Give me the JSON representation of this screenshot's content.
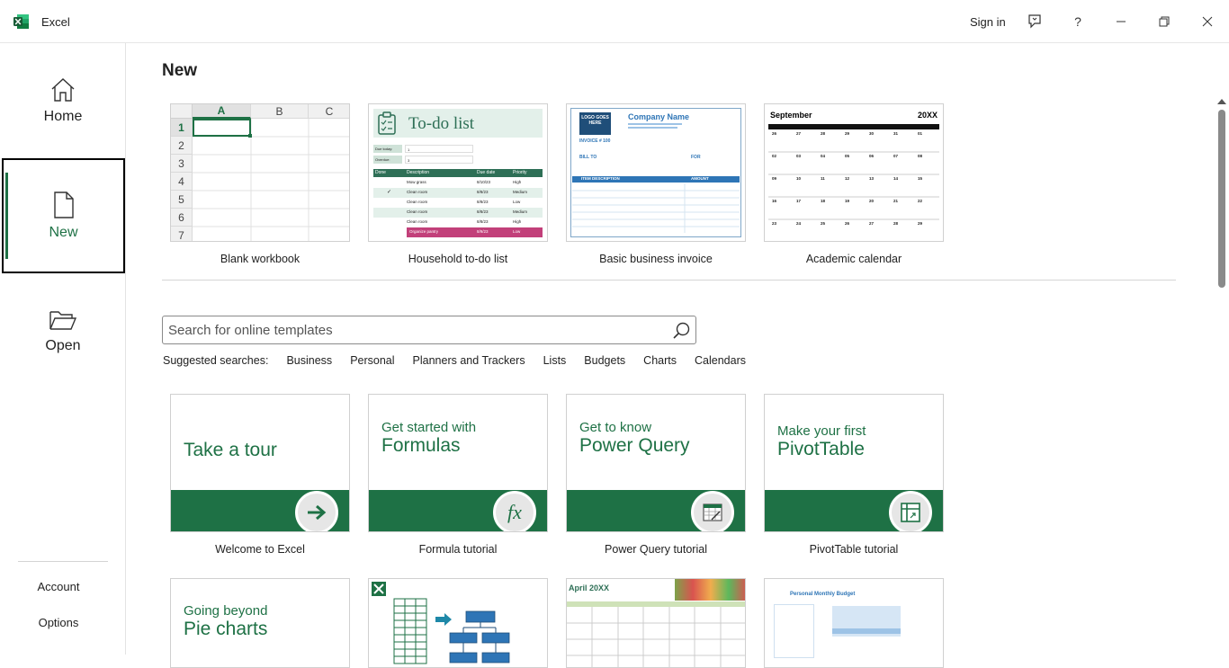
{
  "titlebar": {
    "app_name": "Excel",
    "sign_in": "Sign in",
    "help": "?"
  },
  "sidebar": {
    "items": [
      {
        "label": "Home",
        "icon": "home-icon"
      },
      {
        "label": "New",
        "icon": "new-file-icon",
        "selected": true
      },
      {
        "label": "Open",
        "icon": "open-folder-icon"
      }
    ],
    "account": "Account",
    "options": "Options"
  },
  "main": {
    "title": "New",
    "featured": [
      {
        "caption": "Blank workbook"
      },
      {
        "caption": "Household to-do list"
      },
      {
        "caption": "Basic business invoice"
      },
      {
        "caption": "Academic calendar"
      }
    ],
    "blank_grid": {
      "columns": [
        "A",
        "B",
        "C"
      ],
      "rows": [
        "1",
        "2",
        "3",
        "4",
        "5",
        "6",
        "7"
      ]
    },
    "todo_thumb": {
      "title": "To-do list",
      "headers": [
        "Done",
        "Description",
        "Due date",
        "Priority"
      ],
      "rows": [
        [
          "",
          "Mow grass",
          "8/10/23",
          "High"
        ],
        [
          "✓",
          "Clean room",
          "8/8/23",
          "Medium"
        ],
        [
          "",
          "Clean room",
          "8/8/23",
          "Low"
        ],
        [
          "",
          "Clean room",
          "8/8/23",
          "Medium"
        ],
        [
          "",
          "Clean room",
          "8/8/23",
          "High"
        ],
        [
          "",
          "Organize pantry",
          "8/9/23",
          "Low"
        ]
      ],
      "due_today": "Due today:",
      "overdue": "Overdue:",
      "due_today_val": "1",
      "overdue_val": "3"
    },
    "invoice_thumb": {
      "logo": "LOGO GOES HERE",
      "company": "Company Name",
      "invoice_no": "INVOICE # 100",
      "bill_to": "BILL TO",
      "for": "FOR",
      "item_desc": "ITEM DESCRIPTION",
      "amount": "AMOUNT"
    },
    "calendar_thumb": {
      "month": "September",
      "year": "20XX",
      "days": [
        [
          "28",
          "29",
          "30",
          "31",
          "1",
          "2",
          "3"
        ],
        [
          "4",
          "5",
          "6",
          "7",
          "8",
          "9",
          "10"
        ],
        [
          "11",
          "12",
          "13",
          "14",
          "15",
          "16",
          "17"
        ],
        [
          "18",
          "19",
          "20",
          "21",
          "22",
          "23",
          "24"
        ],
        [
          "25",
          "26",
          "27",
          "28",
          "29",
          "30",
          "1"
        ]
      ],
      "cal_rows": [
        [
          "27",
          "28",
          "29",
          "30",
          "31",
          "01"
        ],
        [
          "03",
          "04",
          "05",
          "06",
          "07",
          "08"
        ],
        [
          "10",
          "11",
          "12",
          "13",
          "14",
          "15"
        ],
        [
          "17",
          "18",
          "19",
          "20",
          "21",
          "22"
        ],
        [
          "24",
          "25",
          "26",
          "27",
          "28",
          "29"
        ]
      ],
      "cal_first_col": [
        "26",
        "02",
        "09",
        "16",
        "23"
      ]
    },
    "search": {
      "placeholder": "Search for online templates"
    },
    "suggested": {
      "label": "Suggested searches:",
      "links": [
        "Business",
        "Personal",
        "Planners and Trackers",
        "Lists",
        "Budgets",
        "Charts",
        "Calendars"
      ]
    },
    "learning": [
      {
        "line1": "",
        "line2": "Take a tour",
        "caption": "Welcome to Excel",
        "icon": "arrow-right-icon"
      },
      {
        "line1": "Get started with",
        "line2": "Formulas",
        "caption": "Formula tutorial",
        "icon": "fx-icon"
      },
      {
        "line1": "Get to know",
        "line2": "Power Query",
        "caption": "Power Query tutorial",
        "icon": "power-query-icon"
      },
      {
        "line1": "Make your first",
        "line2": "PivotTable",
        "caption": "PivotTable tutorial",
        "icon": "pivottable-icon"
      }
    ],
    "row3": [
      {
        "line1": "Going beyond",
        "line2": "Pie charts"
      },
      {
        "label": "excel-diagram"
      },
      {
        "month": "April 20XX"
      },
      {
        "title": "Personal Monthly Budget"
      }
    ]
  }
}
